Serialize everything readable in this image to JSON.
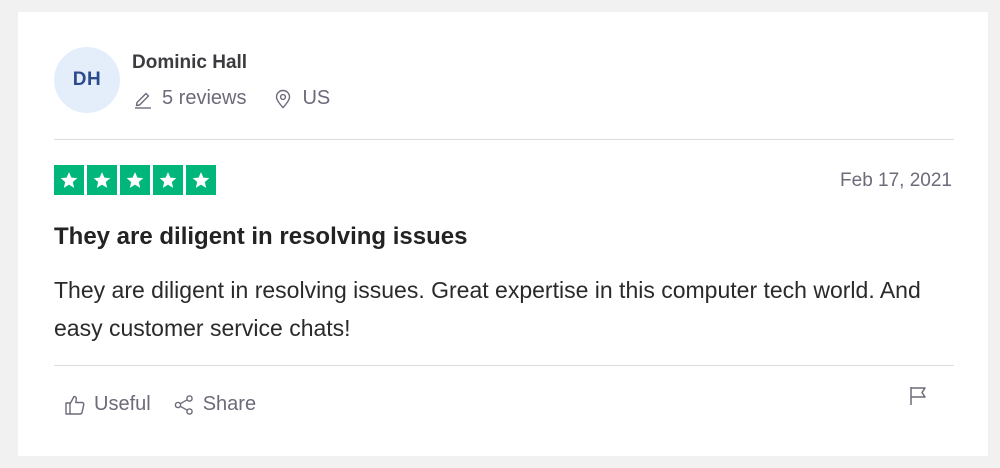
{
  "reviewer": {
    "initials": "DH",
    "name": "Dominic Hall",
    "review_count": "5 reviews",
    "location": "US"
  },
  "rating": {
    "stars": 5,
    "max_stars": 5,
    "star_color": "#00b67a"
  },
  "review": {
    "date": "Feb 17, 2021",
    "title": "They are diligent in resolving issues",
    "body": "They are diligent in resolving issues. Great expertise in this computer tech world. And easy customer service chats!"
  },
  "actions": {
    "useful_label": "Useful",
    "share_label": "Share"
  },
  "icons": {
    "review_count": "pencil-icon",
    "location": "location-pin-icon",
    "useful": "thumbs-up-icon",
    "share": "share-icon",
    "report": "flag-icon",
    "star": "star-icon"
  }
}
